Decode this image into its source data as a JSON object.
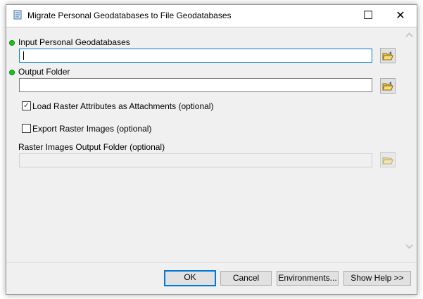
{
  "window": {
    "title": "Migrate Personal Geodatabases to File Geodatabases",
    "maximize": "☐",
    "close": "✕"
  },
  "params": {
    "input_label": "Input Personal Geodatabases",
    "input_value": "",
    "output_label": "Output Folder",
    "output_value": "",
    "load_raster_label": "Load Raster Attributes as Attachments (optional)",
    "load_raster_checked": true,
    "check": "✓",
    "export_raster_label": "Export Raster Images (optional)",
    "export_raster_checked": false,
    "raster_folder_label": "Raster Images Output Folder (optional)",
    "raster_folder_value": ""
  },
  "buttons": {
    "ok": "OK",
    "cancel": "Cancel",
    "env": "Environments...",
    "help": "Show Help >>"
  },
  "colors": {
    "required_dot": "#1ec31e",
    "focus": "#0078d7"
  }
}
